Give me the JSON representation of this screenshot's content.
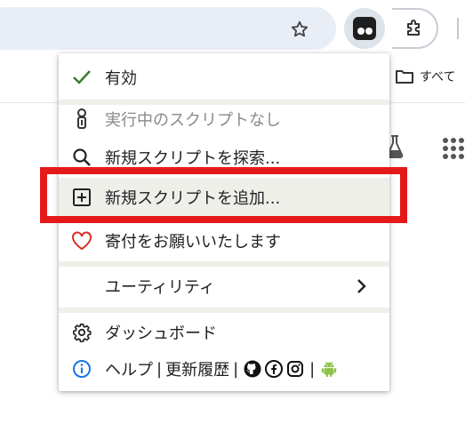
{
  "browser": {
    "bookmark_folder_label": "すべて",
    "icons": [
      "star-icon",
      "tampermonkey-icon",
      "puzzle-icon",
      "folder-icon",
      "flask-icon",
      "apps-grid-icon"
    ]
  },
  "menu": {
    "enabled_label": "有効",
    "no_scripts_label": "実行中のスクリプトなし",
    "find_scripts_label": "新規スクリプトを探索...",
    "add_script_label": "新規スクリプトを追加...",
    "donate_label": "寄付をお願いいたします",
    "utilities_label": "ユーティリティ",
    "dashboard_label": "ダッシュボード",
    "help_label": "ヘルプ",
    "changelog_label": "更新履歴",
    "separator": "|"
  },
  "colors": {
    "check": "#3a7d2c",
    "heart": "#d93025",
    "info": "#1a73e8",
    "android": "#8bc34a",
    "annotation": "#e51919",
    "highlight": "#efefea"
  }
}
